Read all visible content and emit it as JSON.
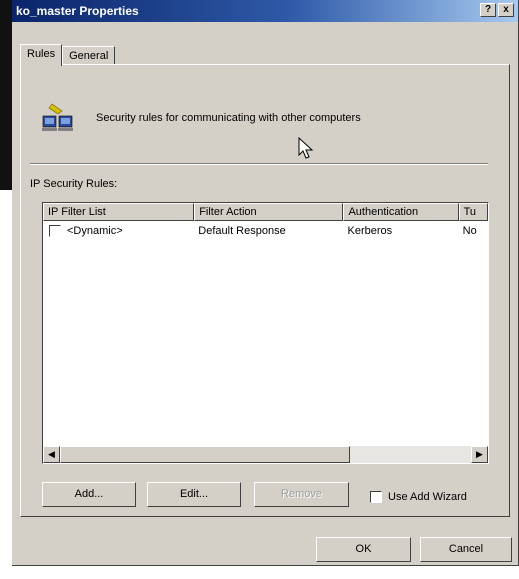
{
  "window": {
    "title": "ko_master Properties",
    "help_btn": "?",
    "close_btn": "x"
  },
  "tabs": [
    {
      "label": "Rules",
      "active": true
    },
    {
      "label": "General",
      "active": false
    }
  ],
  "header": {
    "icon": "security-rules-icon",
    "description": "Security rules for communicating with other computers"
  },
  "section_label": "IP Security Rules:",
  "table": {
    "columns": [
      "IP Filter List",
      "Filter Action",
      "Authentication",
      "Tu"
    ],
    "rows": [
      {
        "checked": false,
        "cells": [
          "<Dynamic>",
          "Default Response",
          "Kerberos",
          "No"
        ]
      }
    ]
  },
  "buttons": {
    "add": "Add...",
    "edit": "Edit...",
    "remove": "Remove",
    "ok": "OK",
    "cancel": "Cancel"
  },
  "wizard": {
    "label": "Use Add Wizard",
    "checked": false
  },
  "scrollbar": {
    "left_arrow": "◀",
    "right_arrow": "▶"
  }
}
